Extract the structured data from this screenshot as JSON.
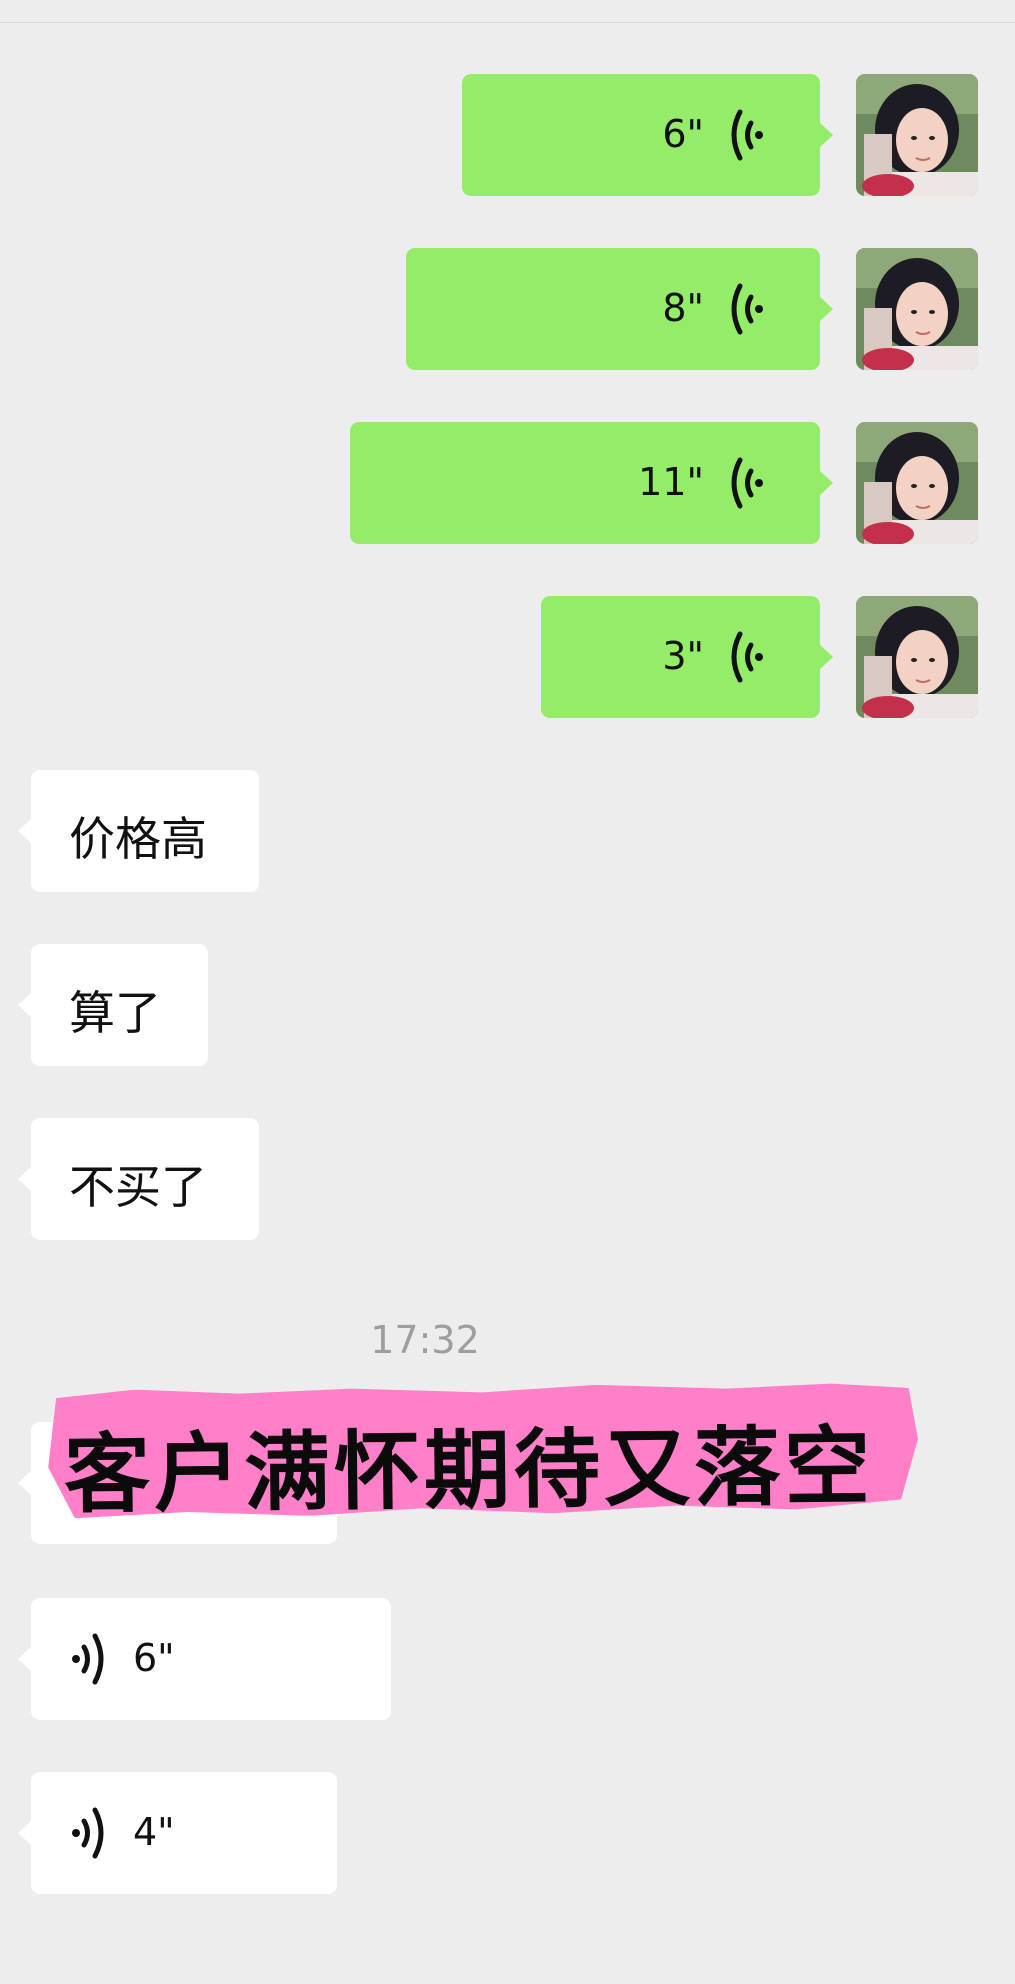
{
  "messages_outgoing": [
    {
      "type": "voice",
      "duration": "6\""
    },
    {
      "type": "voice",
      "duration": "8\""
    },
    {
      "type": "voice",
      "duration": "11\""
    },
    {
      "type": "voice",
      "duration": "3\""
    }
  ],
  "messages_incoming": [
    {
      "type": "text",
      "text": "价格高"
    },
    {
      "type": "text",
      "text": "算了"
    },
    {
      "type": "text",
      "text": "不买了"
    }
  ],
  "timestamp_1": "17:32",
  "overlay_caption": "客户满怀期待又落空",
  "messages_incoming_after": [
    {
      "type": "voice",
      "duration": ""
    },
    {
      "type": "voice",
      "duration": "6\""
    },
    {
      "type": "voice",
      "duration": "4\""
    }
  ],
  "colors": {
    "outgoing_bubble": "#95ec69",
    "incoming_bubble": "#ffffff",
    "background": "#ededed",
    "caption_highlight": "#ff7fc8",
    "timestamp": "#9e9e9e"
  },
  "icons": {
    "outgoing_voice": "voice-wave-icon",
    "incoming_voice": "voice-wave-icon",
    "avatar": "user-avatar"
  }
}
